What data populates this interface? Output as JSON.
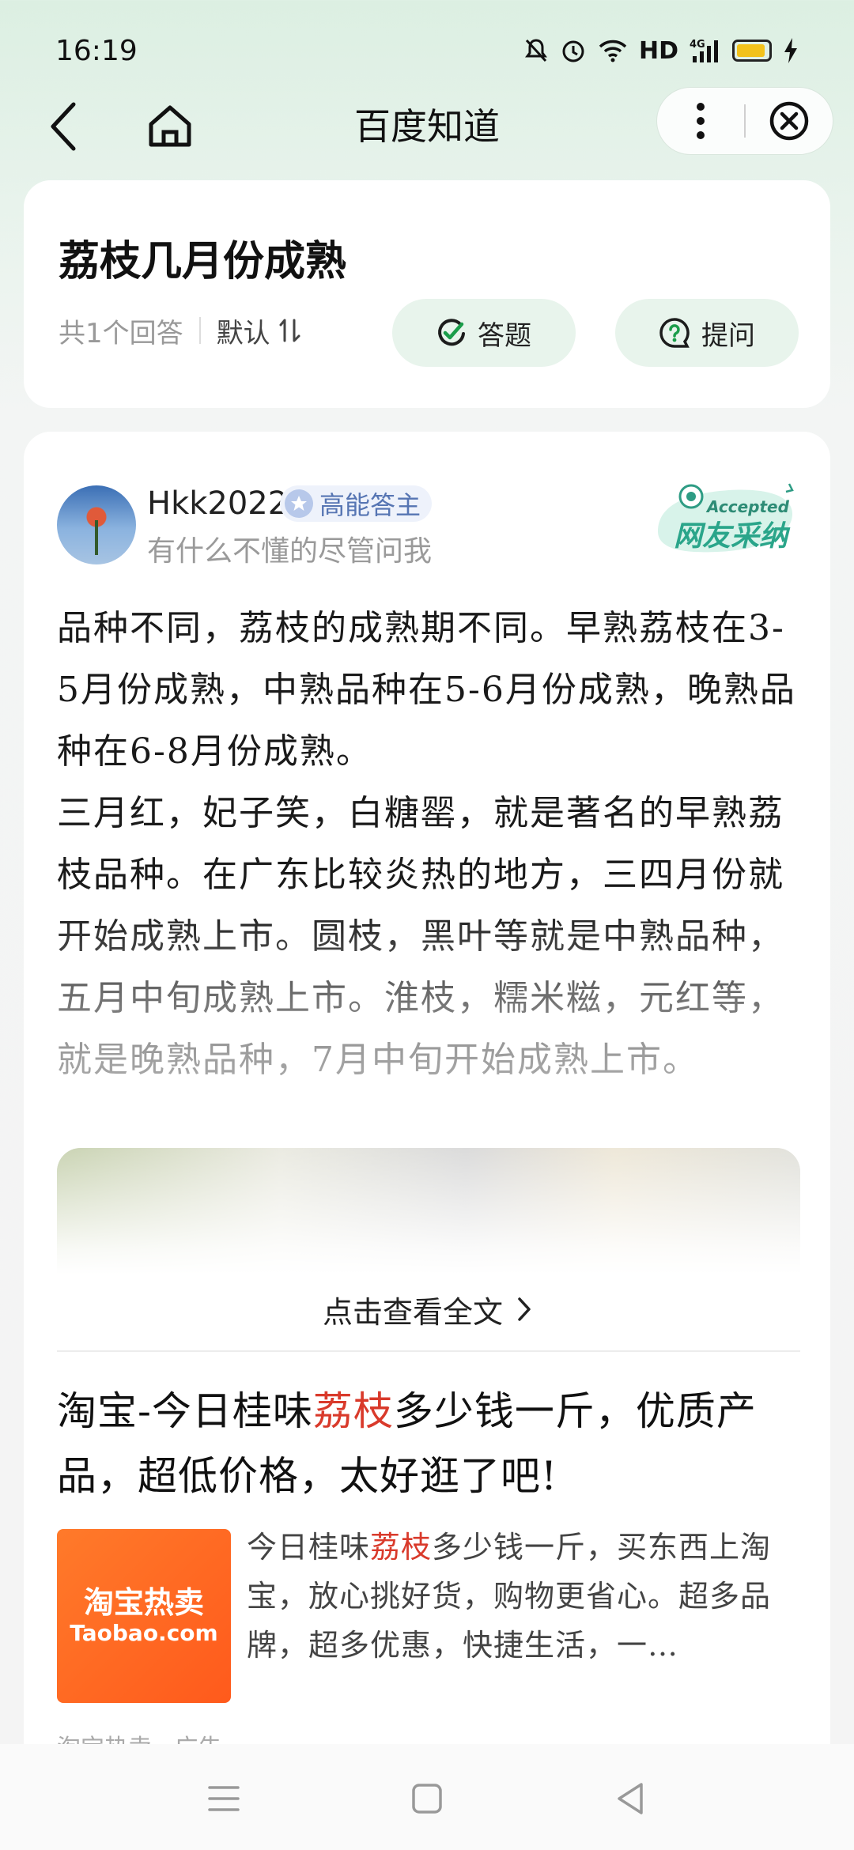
{
  "status_bar": {
    "time": "16:19",
    "network_label": "HD",
    "network_type": "4G",
    "icons": [
      "mute-icon",
      "alarm-icon",
      "wifi-icon",
      "signal-icon",
      "battery-icon",
      "charging-icon"
    ],
    "battery_color": "#f2c21b"
  },
  "nav": {
    "title": "百度知道",
    "back_icon": "back-arrow-icon",
    "home_icon": "home-icon",
    "more_icon": "more-vertical-icon",
    "close_icon": "close-circle-icon"
  },
  "question": {
    "title": "荔枝几月份成熟",
    "answer_count": "共1个回答",
    "sort_label": "默认",
    "answer_button": "答题",
    "ask_button": "提问",
    "accent_color": "#1a9d4a"
  },
  "answer": {
    "username": "Hkk2022",
    "badge": "高能答主",
    "user_desc": "有什么不懂的尽管问我",
    "accepted_en": "Accepted",
    "accepted_cn": "网友采纳",
    "paragraph1": "品种不同，荔枝的成熟期不同。早熟荔枝在3-5月份成熟，中熟品种在5-6月份成熟，晚熟品种在6-8月份成熟。",
    "paragraph2": "三月红，妃子笑，白糖罂，就是著名的早熟荔枝品种。在广东比较炎热的地方，三四月份就开始成熟上市。圆枝，黑叶等就是中熟品种，五月中旬成熟上市。淮枝，糯米糍，元红等，就是晚熟品种，7月中旬开始成熟上市。",
    "view_full": "点击查看全文"
  },
  "ad": {
    "title_pre": "淘宝-今日桂味",
    "title_hl": "荔枝",
    "title_post": "多少钱一斤，优质产品，超低价格，太好逛了吧!",
    "desc_pre": "今日桂味",
    "desc_hl": "荔枝",
    "desc_post": "多少钱一斤，买东西上淘宝，放心挑好货，购物更省心。超多品牌，超多优惠，快捷生活，一…",
    "thumb_cn": "淘宝热卖",
    "thumb_en": "Taobao.com",
    "source": "淘宝热卖 · 广告",
    "highlight_color": "#d93a2b"
  },
  "system_nav": {
    "menu_icon": "menu-icon",
    "home_icon": "square-home-icon",
    "back_icon": "triangle-back-icon"
  }
}
